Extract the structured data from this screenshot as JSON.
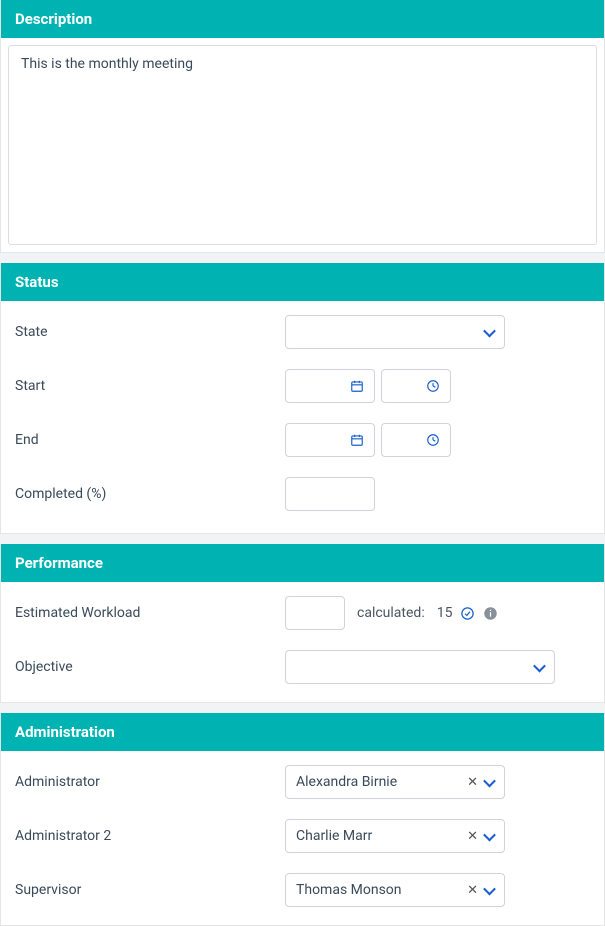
{
  "description": {
    "header": "Description",
    "text": "This is the monthly meeting"
  },
  "status": {
    "header": "Status",
    "state_label": "State",
    "state_value": "",
    "start_label": "Start",
    "start_date": "",
    "start_time": "",
    "end_label": "End",
    "end_date": "",
    "end_time": "",
    "completed_label": "Completed (%)",
    "completed_value": ""
  },
  "performance": {
    "header": "Performance",
    "workload_label": "Estimated Workload",
    "workload_value": "",
    "calculated_label": "calculated:",
    "calculated_value": "15",
    "objective_label": "Objective",
    "objective_value": ""
  },
  "administration": {
    "header": "Administration",
    "admin1_label": "Administrator",
    "admin1_value": "Alexandra Birnie",
    "admin2_label": "Administrator 2",
    "admin2_value": "Charlie Marr",
    "supervisor_label": "Supervisor",
    "supervisor_value": "Thomas Monson"
  }
}
